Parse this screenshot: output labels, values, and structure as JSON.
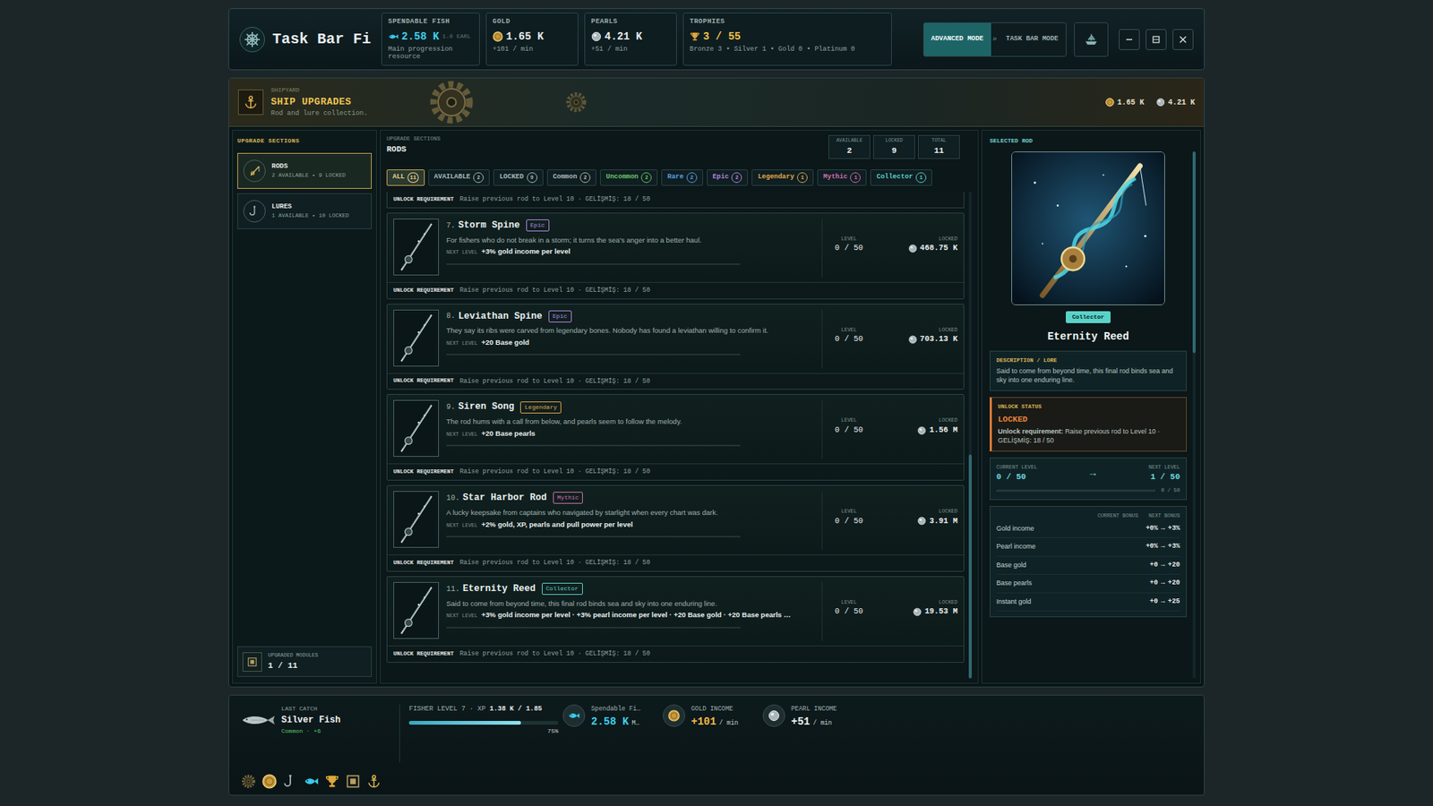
{
  "window": {
    "title": "Task Bar Fi",
    "version": "1.0 EARL"
  },
  "stats": [
    {
      "kind": "fish",
      "label": "SPENDABLE FISH",
      "value": "2.58 K",
      "sub": "Main progression resource"
    },
    {
      "kind": "gold",
      "label": "GOLD",
      "value": "1.65 K",
      "sub": "+101 / min"
    },
    {
      "kind": "pearl",
      "label": "PEARLS",
      "value": "4.21 K",
      "sub": "+51 / min"
    },
    {
      "kind": "trophy",
      "label": "TROPHIES",
      "value": "3 / 55",
      "sub": "Bronze 3 • Silver 1 • Gold 0 • Platinum 0"
    }
  ],
  "modes": [
    {
      "label": "ADVANCED MODE",
      "selected": true
    },
    {
      "label": "TASK BAR MODE",
      "selected": false
    }
  ],
  "mode_separator": "»",
  "banner": {
    "kicker": "SHIPYARD",
    "title": "SHIP UPGRADES",
    "subtitle": "Rod and lure collection.",
    "gold": "1.65 K",
    "pearls": "4.21 K"
  },
  "sidebar": {
    "header": "UPGRADE SECTIONS",
    "items": [
      {
        "kind": "rods",
        "name": "RODS",
        "sub": "2 AVAILABLE • 9 LOCKED",
        "selected": true
      },
      {
        "kind": "lures",
        "name": "LURES",
        "sub": "1 AVAILABLE • 10 LOCKED",
        "selected": false
      }
    ],
    "footer": {
      "label": "UPGRADED MODULES",
      "value": "1 / 11"
    }
  },
  "section": {
    "kicker": "UPGRADE SECTIONS",
    "title": "RODS",
    "counts": [
      {
        "label": "AVAILABLE",
        "value": "2"
      },
      {
        "label": "LOCKED",
        "value": "9"
      },
      {
        "label": "TOTAL",
        "value": "11"
      }
    ]
  },
  "filters": [
    {
      "label": "ALL",
      "count": "11",
      "selected": true,
      "color": "#f0d38a"
    },
    {
      "label": "AVAILABLE",
      "count": "2",
      "selected": false,
      "color": "#a9bcba"
    },
    {
      "label": "LOCKED",
      "count": "9",
      "selected": false,
      "color": "#a9bcba"
    },
    {
      "label": "Common",
      "count": "2",
      "selected": false,
      "color": "#b0b8ba"
    },
    {
      "label": "Uncommon",
      "count": "2",
      "selected": false,
      "color": "#6cc46a"
    },
    {
      "label": "Rare",
      "count": "2",
      "selected": false,
      "color": "#5aa0e6"
    },
    {
      "label": "Epic",
      "count": "2",
      "selected": false,
      "color": "#b48ae0"
    },
    {
      "label": "Legendary",
      "count": "1",
      "selected": false,
      "color": "#e0a84a"
    },
    {
      "label": "Mythic",
      "count": "1",
      "selected": false,
      "color": "#d070b0"
    },
    {
      "label": "Collector",
      "count": "1",
      "selected": false,
      "color": "#5ad2c8"
    }
  ],
  "previous_requirement": {
    "label": "UNLOCK REQUIREMENT",
    "text": "Raise previous rod to Level 10 · GELİŞMİŞ: 18 / 50"
  },
  "rods": [
    {
      "index": "7.",
      "name": "Storm Spine",
      "rarity": "Epic",
      "color": "#b48ae0",
      "desc": "For fishers who do not break in a storm; it turns the sea's anger into a better haul.",
      "next_label": "NEXT LEVEL",
      "next": "+3% gold income per level",
      "level_label": "LEVEL",
      "level_text": "0 / 50",
      "level": 0,
      "status": "LOCKED",
      "cost": "468.75 K",
      "req_label": "UNLOCK REQUIREMENT",
      "requirement": "Raise previous rod to Level 10 · GELİŞMİŞ: 18 / 50"
    },
    {
      "index": "8.",
      "name": "Leviathan Spine",
      "rarity": "Epic",
      "color": "#b48ae0",
      "desc": "They say its ribs were carved from legendary bones. Nobody has found a leviathan willing to confirm it.",
      "next_label": "NEXT LEVEL",
      "next": "+20 Base gold",
      "level_label": "LEVEL",
      "level_text": "0 / 50",
      "level": 0,
      "status": "LOCKED",
      "cost": "703.13 K",
      "req_label": "UNLOCK REQUIREMENT",
      "requirement": "Raise previous rod to Level 10 · GELİŞMİŞ: 18 / 50"
    },
    {
      "index": "9.",
      "name": "Siren Song",
      "rarity": "Legendary",
      "color": "#e0a84a",
      "desc": "The rod hums with a call from below, and pearls seem to follow the melody.",
      "next_label": "NEXT LEVEL",
      "next": "+20 Base pearls",
      "level_label": "LEVEL",
      "level_text": "0 / 50",
      "level": 0,
      "status": "LOCKED",
      "cost": "1.56 M",
      "req_label": "UNLOCK REQUIREMENT",
      "requirement": "Raise previous rod to Level 10 · GELİŞMİŞ: 18 / 50"
    },
    {
      "index": "10.",
      "name": "Star Harbor Rod",
      "rarity": "Mythic",
      "color": "#d070b0",
      "desc": "A lucky keepsake from captains who navigated by starlight when every chart was dark.",
      "next_label": "NEXT LEVEL",
      "next": "+2% gold, XP, pearls and pull power per level",
      "level_label": "LEVEL",
      "level_text": "0 / 50",
      "level": 0,
      "status": "LOCKED",
      "cost": "3.91 M",
      "req_label": "UNLOCK REQUIREMENT",
      "requirement": "Raise previous rod to Level 10 · GELİŞMİŞ: 18 / 50"
    },
    {
      "index": "11.",
      "name": "Eternity Reed",
      "rarity": "Collector",
      "color": "#5ad2c8",
      "desc": "Said to come from beyond time, this final rod binds sea and sky into one enduring line.",
      "next_label": "NEXT LEVEL",
      "next": "+3% gold income per level · +3% pearl income per level · +20 Base gold · +20 Base pearls …",
      "level_label": "LEVEL",
      "level_text": "0 / 50",
      "level": 0,
      "status": "LOCKED",
      "cost": "19.53 M",
      "req_label": "UNLOCK REQUIREMENT",
      "requirement": "Raise previous rod to Level 10 · GELİŞMİŞ: 18 / 50"
    }
  ],
  "selected": {
    "header": "SELECTED ROD",
    "rarity": "Collector",
    "color": "#5ad2c8",
    "name": "Eternity Reed",
    "lore_label": "DESCRIPTION / LORE",
    "lore": "Said to come from beyond time, this final rod binds sea and sky into one enduring line.",
    "status_label": "UNLOCK STATUS",
    "status": "LOCKED",
    "req_label": "Unlock requirement:",
    "requirement": "Raise previous rod to Level 10 · GELİŞMİŞ: 18 / 50",
    "current_label": "CURRENT LEVEL",
    "current": "0 / 50",
    "arrow": "→",
    "next_label": "NEXT LEVEL",
    "next": "1 / 50",
    "level": 0,
    "progress_text": "0 / 50",
    "bonus_headers": [
      "CURRENT BONUS",
      "NEXT BONUS"
    ],
    "bonuses": [
      {
        "name": "Gold income",
        "current": "+0%",
        "next": "+3%"
      },
      {
        "name": "Pearl income",
        "current": "+0%",
        "next": "+3%"
      },
      {
        "name": "Base gold",
        "current": "+0",
        "next": "+20"
      },
      {
        "name": "Base pearls",
        "current": "+0",
        "next": "+20"
      },
      {
        "name": "Instant gold",
        "current": "+0",
        "next": "+25"
      }
    ]
  },
  "bottom": {
    "last_catch": {
      "label": "LAST CATCH",
      "name": "Silver Fish",
      "rarity": "Common · +6"
    },
    "fisher": {
      "label": "FISHER LEVEL 7 · XP",
      "xp": "1.38 K / 1.85",
      "level": 0.75,
      "percent": "75%"
    },
    "incomes": [
      {
        "kind": "fish",
        "label": "Spendable Fi…",
        "value": "2.58 K",
        "unit": "M…"
      },
      {
        "kind": "gold",
        "label": "GOLD INCOME",
        "value": "+101",
        "unit": "/ min"
      },
      {
        "kind": "pearl",
        "label": "PEARL INCOME",
        "value": "+51",
        "unit": "/ min"
      }
    ]
  }
}
